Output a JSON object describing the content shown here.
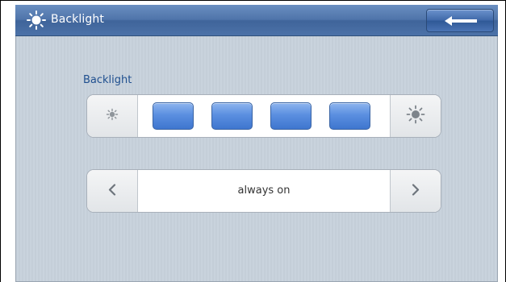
{
  "header": {
    "title": "Backlight",
    "title_icon": "sun-icon",
    "back_icon": "back-arrow-icon"
  },
  "backlight_section": {
    "label": "Backlight",
    "decrease_icon": "dim-sun-icon",
    "increase_icon": "bright-sun-icon",
    "level": 4,
    "max_level": 4
  },
  "mode_selector": {
    "value": "always on",
    "prev_icon": "chevron-left-icon",
    "next_icon": "chevron-right-icon"
  },
  "colors": {
    "titlebar": "#4f74aa",
    "level_fill": "#5b8fe0",
    "label_text": "#1f4f8f"
  }
}
